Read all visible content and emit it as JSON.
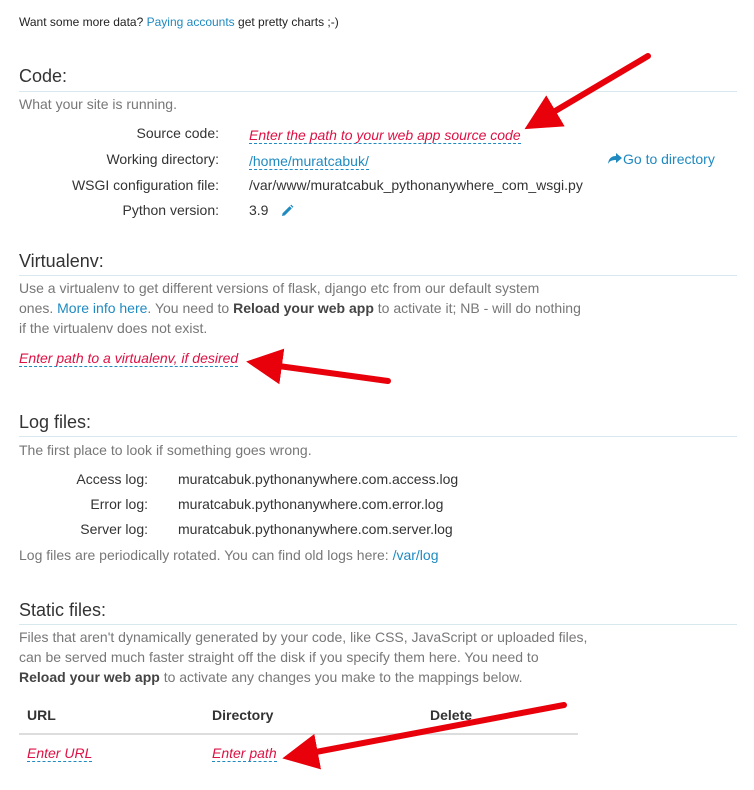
{
  "top_note": {
    "prefix": "Want some more data?",
    "link": "Paying accounts",
    "suffix": "get pretty charts ;-)"
  },
  "code": {
    "title": "Code:",
    "description": "What your site is running.",
    "source_code_label": "Source code:",
    "source_code_placeholder": "Enter the path to your web app source code",
    "working_dir_label": "Working directory:",
    "working_dir_value": "/home/muratcabuk/",
    "go_to_directory": "Go to directory",
    "wsgi_label": "WSGI configuration file:",
    "wsgi_value": "/var/www/muratcabuk_pythonanywhere_com_wsgi.py",
    "python_label": "Python version:",
    "python_value": "3.9"
  },
  "virtualenv": {
    "title": "Virtualenv:",
    "desc_1": "Use a virtualenv to get different versions of flask, django etc from our default system",
    "desc_2_prefix": "ones.",
    "desc_2_link": "More info here",
    "desc_2_mid": ". You need to",
    "desc_2_bold": "Reload your web app",
    "desc_2_suffix": "to activate it; NB - will do nothing",
    "desc_3": "if the virtualenv does not exist.",
    "placeholder": "Enter path to a virtualenv, if desired"
  },
  "logs": {
    "title": "Log files:",
    "description": "The first place to look if something goes wrong.",
    "access_label": "Access log:",
    "access_value": "muratcabuk.pythonanywhere.com.access.log",
    "error_label": "Error log:",
    "error_value": "muratcabuk.pythonanywhere.com.error.log",
    "server_label": "Server log:",
    "server_value": "muratcabuk.pythonanywhere.com.server.log",
    "rotated_text": "Log files are periodically rotated. You can find old logs here:",
    "rotated_link": "/var/log"
  },
  "static": {
    "title": "Static files:",
    "desc_1": "Files that aren't dynamically generated by your code, like CSS, JavaScript or uploaded files,",
    "desc_2": "can be served much faster straight off the disk if you specify them here. You need to",
    "desc_3_bold": "Reload your web app",
    "desc_3_suffix": "to activate any changes you make to the mappings below.",
    "col_url": "URL",
    "col_directory": "Directory",
    "col_delete": "Delete",
    "url_placeholder": "Enter URL",
    "path_placeholder": "Enter path"
  },
  "colors": {
    "accent": "#1f8ac0",
    "editable": "#dd1144",
    "annotation_arrow": "#e8000b"
  }
}
